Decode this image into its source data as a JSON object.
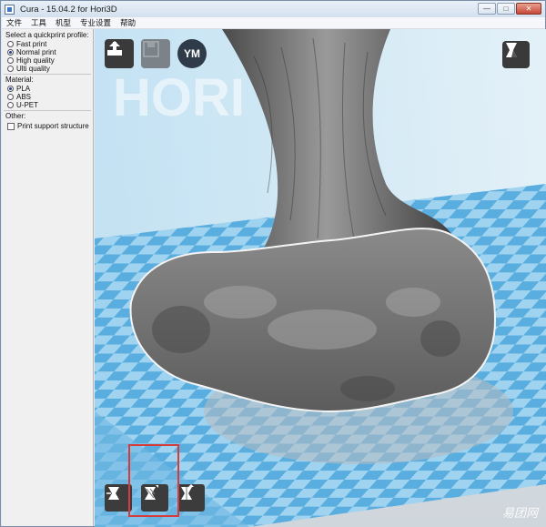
{
  "window": {
    "title": "Cura - 15.04.2 for Hori3D",
    "controls": {
      "minimize": "—",
      "maximize": "□",
      "close": "✕"
    }
  },
  "menu": [
    "文件",
    "工具",
    "机型",
    "专业设置",
    "帮助"
  ],
  "left_panel": {
    "quickprint_label": "Select a quickprint profile:",
    "profiles": [
      {
        "label": "Fast print",
        "selected": false
      },
      {
        "label": "Normal print",
        "selected": true
      },
      {
        "label": "High quality",
        "selected": false
      },
      {
        "label": "Ulti quality",
        "selected": false
      }
    ],
    "material_label": "Material:",
    "materials": [
      {
        "label": "PLA",
        "selected": true
      },
      {
        "label": "ABS",
        "selected": false
      },
      {
        "label": "U-PET",
        "selected": false
      }
    ],
    "other_label": "Other:",
    "support_label": "Print support structure",
    "support_checked": false
  },
  "viewport": {
    "buttons": {
      "load": "load-icon",
      "save": "save-icon",
      "ym_label": "YM",
      "view_mode": "view-mode-icon"
    },
    "bed_watermark": "HORI",
    "bottom_tools": [
      "rotate-icon",
      "scale-icon",
      "mirror-icon"
    ],
    "colors": {
      "bed_light": "#9fd3ef",
      "bed_dark": "#5aaedf",
      "model": "#6e6e6e",
      "highlight": "#d83a3a"
    }
  },
  "watermark": "易团网"
}
